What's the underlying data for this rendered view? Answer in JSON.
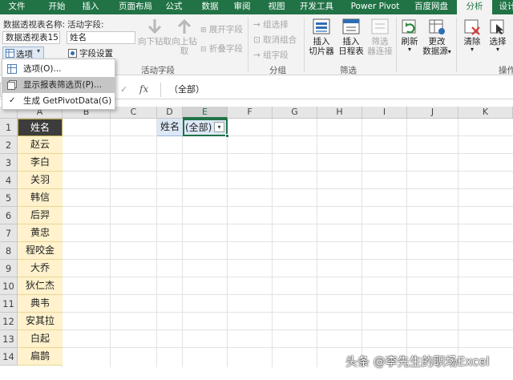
{
  "tabs": [
    "文件",
    "开始",
    "插入",
    "页面布局",
    "公式",
    "数据",
    "审阅",
    "视图",
    "开发工具",
    "Power Pivot",
    "百度网盘",
    "分析",
    "设计"
  ],
  "active_tab": "分析",
  "pivot": {
    "name_label": "数据透视表名称:",
    "name_value": "数据透视表15",
    "options_label": "选项",
    "active_field_label": "活动字段:",
    "active_field_value": "姓名",
    "field_settings_label": "字段设置",
    "drill_down": "向下钻取",
    "drill_up_1": "向上钻",
    "drill_up_2": "取",
    "expand_field": "展开字段",
    "collapse_field": "折叠字段",
    "group_active_field_label": "活动字段",
    "group_selection": "组选择",
    "ungroup": "取消组合",
    "group_field": "组字段",
    "group_group_label": "分组",
    "insert_slicer_1": "插入",
    "insert_slicer_2": "切片器",
    "insert_timeline_1": "插入",
    "insert_timeline_2": "日程表",
    "filter_conn_1": "筛选",
    "filter_conn_2": "器连接",
    "group_filter_label": "筛选",
    "refresh": "刷新",
    "change_source_1": "更改",
    "change_source_2": "数据源",
    "clear": "清除",
    "select": "选择",
    "group_actions_label": "操作"
  },
  "dropdown_menu": {
    "items": [
      {
        "label": "选项(O)..."
      },
      {
        "label": "显示报表筛选页(P)..."
      },
      {
        "label": "生成 GetPivotData(G)"
      }
    ]
  },
  "formula_bar": {
    "fx": "fx",
    "value": "（全部）"
  },
  "columns": [
    "A",
    "B",
    "C",
    "D",
    "E",
    "F",
    "G",
    "H",
    "I",
    "J",
    "K"
  ],
  "rows": [
    "1",
    "2",
    "3",
    "4",
    "5",
    "6",
    "7",
    "8",
    "9",
    "10",
    "11",
    "12",
    "13",
    "14"
  ],
  "sheet": {
    "header": "姓名",
    "names": [
      "赵云",
      "李白",
      "关羽",
      "韩信",
      "后羿",
      "黄忠",
      "程咬金",
      "大乔",
      "狄仁杰",
      "典韦",
      "安其拉",
      "白起",
      "扁鹊"
    ],
    "filter_label": "姓名",
    "filter_value": "(全部)"
  },
  "colors": {
    "excel_green": "#217346",
    "header_fill": "#3c3c3c",
    "yellow_fill": "#fff2cc",
    "blue_fill": "#dde8f7"
  },
  "watermark": "头条 @李先生的职场Excel"
}
